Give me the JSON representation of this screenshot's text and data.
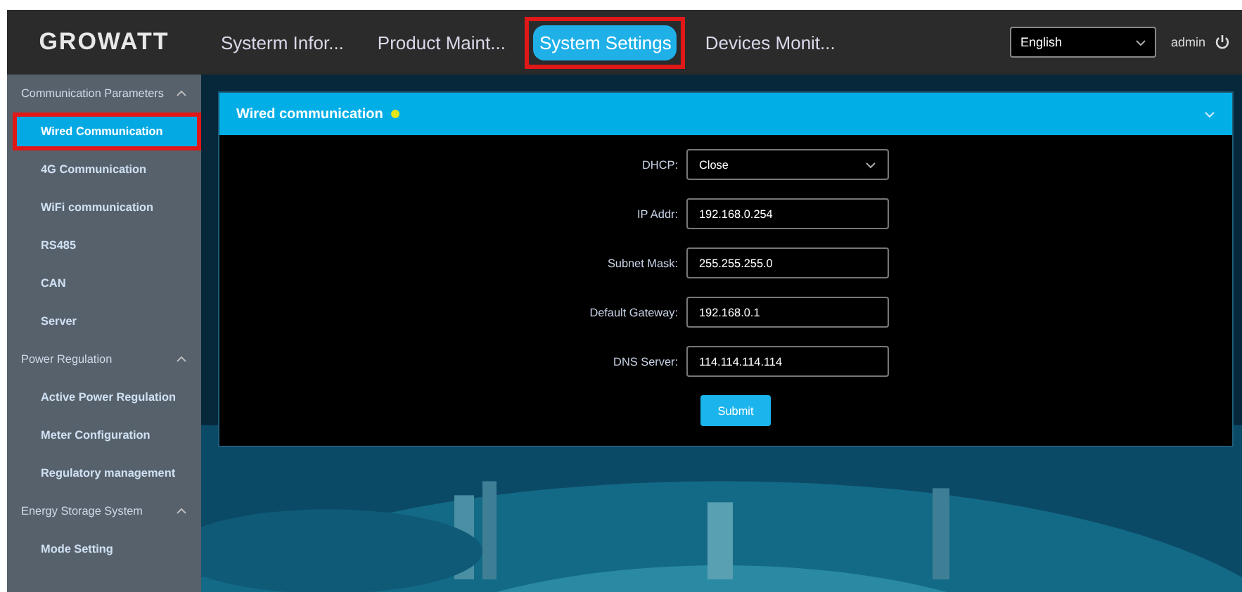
{
  "header": {
    "logo": "GROWATT",
    "tabs": [
      {
        "label": "Systerm Infor...",
        "selected": false,
        "highlighted": false
      },
      {
        "label": "Product Maint...",
        "selected": false,
        "highlighted": false
      },
      {
        "label": "System Settings",
        "selected": true,
        "highlighted": true
      },
      {
        "label": "Devices Monit...",
        "selected": false,
        "highlighted": false
      }
    ],
    "language": {
      "value": "English"
    },
    "user": "admin"
  },
  "sidebar": {
    "groups": [
      {
        "label": "Communication Parameters",
        "expanded": true,
        "children": [
          {
            "label": "Wired Communication",
            "selected": true,
            "highlighted": true
          },
          {
            "label": "4G Communication",
            "selected": false,
            "highlighted": false
          },
          {
            "label": "WiFi communication",
            "selected": false,
            "highlighted": false
          },
          {
            "label": "RS485",
            "selected": false,
            "highlighted": false
          },
          {
            "label": "CAN",
            "selected": false,
            "highlighted": false
          },
          {
            "label": "Server",
            "selected": false,
            "highlighted": false
          }
        ]
      },
      {
        "label": "Power Regulation",
        "expanded": true,
        "children": [
          {
            "label": "Active Power Regulation",
            "selected": false,
            "highlighted": false
          },
          {
            "label": "Meter Configuration",
            "selected": false,
            "highlighted": false
          },
          {
            "label": "Regulatory management",
            "selected": false,
            "highlighted": false
          }
        ]
      },
      {
        "label": "Energy Storage System",
        "expanded": true,
        "children": [
          {
            "label": "Mode Setting",
            "selected": false,
            "highlighted": false
          }
        ]
      }
    ]
  },
  "panel": {
    "title": "Wired communication",
    "status_dot": true,
    "expanded": true,
    "fields": [
      {
        "kind": "select",
        "label": "DHCP:",
        "value": "Close"
      },
      {
        "kind": "text",
        "label": "IP Addr:",
        "value": "192.168.0.254"
      },
      {
        "kind": "text",
        "label": "Subnet Mask:",
        "value": "255.255.255.0"
      },
      {
        "kind": "text",
        "label": "Default Gateway:",
        "value": "192.168.0.1"
      },
      {
        "kind": "text",
        "label": "DNS Server:",
        "value": "114.114.114.114"
      }
    ],
    "submit": "Submit"
  }
}
